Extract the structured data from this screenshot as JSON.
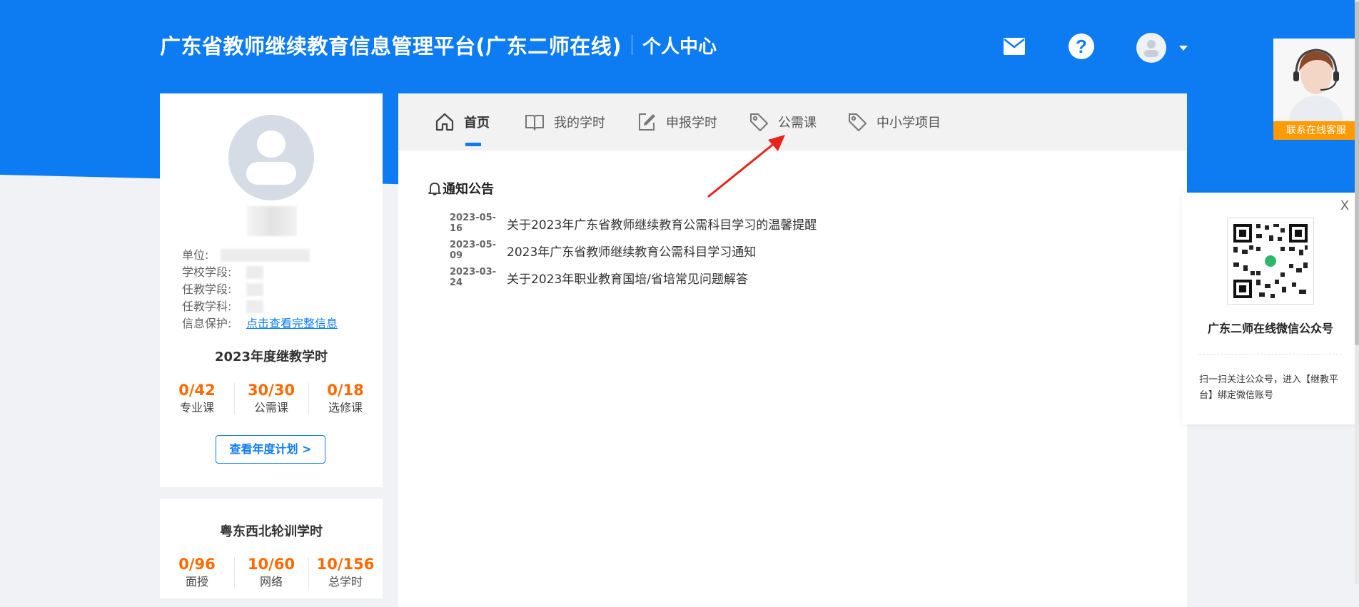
{
  "header": {
    "title": "广东省教师继续教育信息管理平台(广东二师在线)",
    "subtitle": "个人中心",
    "help_glyph": "?"
  },
  "profile": {
    "info_rows": [
      {
        "label": "单位:"
      },
      {
        "label": "学校学段:"
      },
      {
        "label": "任教学段:"
      },
      {
        "label": "任教学科:"
      },
      {
        "label": "信息保护:",
        "link": "点击查看完整信息"
      }
    ],
    "year_title": "2023年度继教学时",
    "year_stats": [
      {
        "value": "0/42",
        "label": "专业课"
      },
      {
        "value": "30/30",
        "label": "公需课"
      },
      {
        "value": "0/18",
        "label": "选修课"
      }
    ],
    "plan_button": "查看年度计划 >"
  },
  "rotation": {
    "title": "粤东西北轮训学时",
    "stats": [
      {
        "value": "0/96",
        "label": "面授"
      },
      {
        "value": "10/60",
        "label": "网络"
      },
      {
        "value": "10/156",
        "label": "总学时"
      }
    ]
  },
  "tabs": [
    {
      "label": "首页",
      "icon": "home-icon"
    },
    {
      "label": "我的学时",
      "icon": "book-icon"
    },
    {
      "label": "申报学时",
      "icon": "edit-icon"
    },
    {
      "label": "公需课",
      "icon": "tag-icon"
    },
    {
      "label": "中小学项目",
      "icon": "tag-icon"
    }
  ],
  "notices": {
    "heading": "通知公告",
    "items": [
      {
        "date": "2023-05-16",
        "title": "关于2023年广东省教师继续教育公需科目学习的温馨提醒"
      },
      {
        "date": "2023-05-09",
        "title": "2023年广东省教师继续教育公需科目学习通知"
      },
      {
        "date": "2023-03-24",
        "title": "关于2023年职业教育国培/省培常见问题解答"
      }
    ]
  },
  "customer_service": {
    "label": "联系在线客服"
  },
  "wechat": {
    "close": "X",
    "title": "广东二师在线微信公众号",
    "desc": "扫一扫关注公众号，进入【继教平台】绑定微信账号"
  },
  "colors": {
    "brand_blue": "#0d7cf2",
    "stat_orange": "#ff6a00",
    "service_orange": "#ff9a00"
  }
}
